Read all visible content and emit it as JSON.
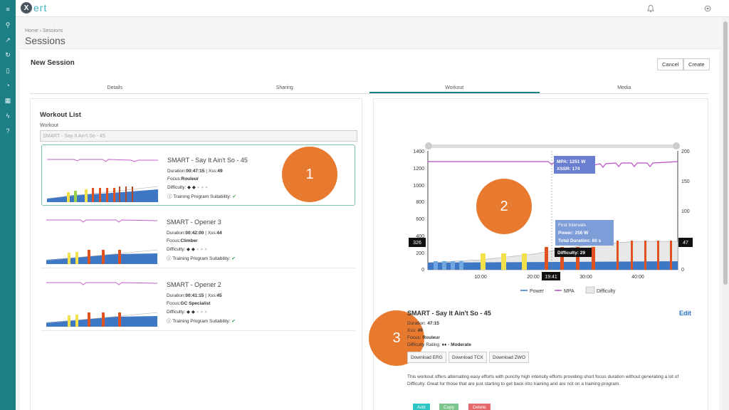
{
  "app": {
    "logo_text": "ert",
    "logo_mark": "X"
  },
  "sidebar": {
    "items": [
      {
        "icon": "menu-icon",
        "glyph": "≡"
      },
      {
        "icon": "user-icon",
        "glyph": "⚲"
      },
      {
        "icon": "chart-line-icon",
        "glyph": "↗"
      },
      {
        "icon": "refresh-icon",
        "glyph": "↻"
      },
      {
        "icon": "mobile-icon",
        "glyph": "▯"
      },
      {
        "icon": "gauge-icon",
        "glyph": "◔"
      },
      {
        "icon": "calendar-icon",
        "glyph": "▦"
      },
      {
        "icon": "bolt-icon",
        "glyph": "ϟ"
      },
      {
        "icon": "help-icon",
        "glyph": "?"
      }
    ]
  },
  "header": {
    "breadcrumb": "Home › Sessions",
    "title": "Sessions",
    "section_title": "New Session",
    "cancel_label": "Cancel",
    "create_label": "Create"
  },
  "tabs": [
    {
      "label": "Details",
      "active": false
    },
    {
      "label": "Sharing",
      "active": false
    },
    {
      "label": "Workout",
      "active": true
    },
    {
      "label": "Media",
      "active": false
    }
  ],
  "workout_list": {
    "title": "Workout List",
    "field_label": "Workout",
    "field_value": "SMART - Say It Ain't So - 45",
    "cards": [
      {
        "title": "SMART - Say It Ain't So - 45",
        "duration_label": "Duration:",
        "duration": "00:47:15",
        "xss_label": " | Xss:",
        "xss": "49",
        "focus_label": "Focus:",
        "focus": "Rouleur",
        "difficulty_label": "Difficulty:",
        "difficulty_level": 2,
        "suitability": "Training Program Suitability:"
      },
      {
        "title": "SMART - Opener 3",
        "duration_label": "Duration:",
        "duration": "00:42:00",
        "xss_label": " | Xss:",
        "xss": "44",
        "focus_label": "Focus:",
        "focus": "Climber",
        "difficulty_label": "Difficulty:",
        "difficulty_level": 2,
        "suitability": "Training Program Suitability:"
      },
      {
        "title": "SMART - Opener 2",
        "duration_label": "Duration:",
        "duration": "00:41:15",
        "xss_label": " | Xss:",
        "xss": "45",
        "focus_label": "Focus:",
        "focus": "GC Specialist",
        "difficulty_label": "Difficulty:",
        "difficulty_level": 2,
        "suitability": "Training Program Suitability:"
      }
    ]
  },
  "callouts": [
    "1",
    "2",
    "3"
  ],
  "chart": {
    "left_axis_ticks": [
      "1400",
      "1200",
      "1000",
      "800",
      "600",
      "400",
      "200",
      "0"
    ],
    "right_axis_ticks": [
      "200",
      "150",
      "100",
      "50",
      "0"
    ],
    "x_ticks": [
      "10:00",
      "20:00",
      "30:00",
      "40:00"
    ],
    "left_marker": "326",
    "right_marker": "47",
    "cursor_label": "19:41",
    "tooltip_mpa": "MPA: 1251 W",
    "tooltip_xssr": "XSSR: 174",
    "tooltip_interval_title": "First Intervals",
    "tooltip_interval_power": "Power: 256 W",
    "tooltip_interval_duration": "Total Duration: 60 s",
    "tooltip_difficulty": "Difficulty: 29",
    "legend": [
      "Power",
      "MPA",
      "Difficulty"
    ],
    "colors": {
      "mpa": "#b94ec4",
      "power": "#3e78c5",
      "difficulty": "#999999",
      "interval": "#e0521f",
      "highlight": "#f2e14a"
    }
  },
  "details": {
    "title": "SMART - Say It Ain't So - 45",
    "edit_label": "Edit",
    "duration_label": "Duration:",
    "duration": "47:15",
    "xss_label": "Xss:",
    "xss": "49",
    "focus_label": "Focus:",
    "focus": "Rouleur",
    "difficulty_label": "Difficulty Rating:",
    "difficulty": "♦♦ - Moderate",
    "buttons": [
      "Download ERG",
      "Download TCX",
      "Download ZWO"
    ],
    "description": "This workout offers alternating easy efforts with punchy high intensity efforts providing short focus duration without generating a lot of Difficulty. Great for those that are just starting to get back into training and are not on a training program.",
    "bottom_buttons": [
      "Add",
      "Copy",
      "Delete"
    ]
  }
}
